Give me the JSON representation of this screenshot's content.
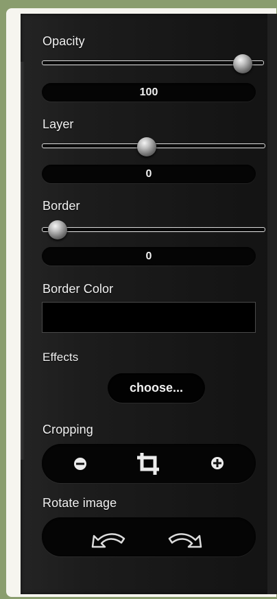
{
  "opacity": {
    "label": "Opacity",
    "value": "100",
    "level": 1.0
  },
  "layer": {
    "label": "Layer",
    "value": "0",
    "level": 0.5
  },
  "border": {
    "label": "Border",
    "value": "0",
    "level": 0.0
  },
  "border_color": {
    "label": "Border Color",
    "value": "#000000"
  },
  "effects": {
    "label": "Effects",
    "button_label": "choose..."
  },
  "cropping": {
    "label": "Cropping",
    "icons": [
      "zoom-out-icon",
      "crop-icon",
      "zoom-in-icon"
    ]
  },
  "rotate": {
    "label": "Rotate image",
    "icons": [
      "rotate-left-icon",
      "rotate-right-icon"
    ]
  }
}
